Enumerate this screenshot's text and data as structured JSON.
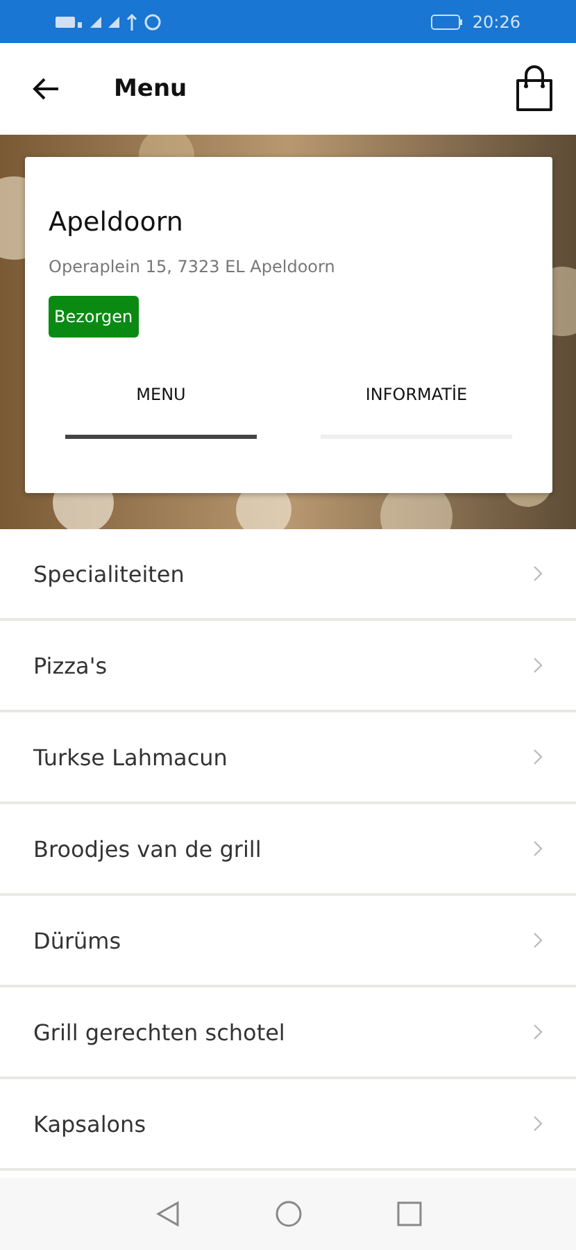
{
  "status_bar": {
    "time": "20:26"
  },
  "header": {
    "title": "Menu"
  },
  "restaurant": {
    "name": "Apeldoorn",
    "address": "Operaplein 15, 7323 EL Apeldoorn",
    "badge": "Bezorgen"
  },
  "tabs": [
    {
      "label": "MENU",
      "selected": true
    },
    {
      "label": "INFORMATİE",
      "selected": false
    }
  ],
  "categories": [
    {
      "label": "Specialiteiten"
    },
    {
      "label": "Pizza's"
    },
    {
      "label": "Turkse Lahmacun"
    },
    {
      "label": "Broodjes van de grill"
    },
    {
      "label": "Dürüms"
    },
    {
      "label": "Grill gerechten schotel"
    },
    {
      "label": "Kapsalons"
    }
  ]
}
